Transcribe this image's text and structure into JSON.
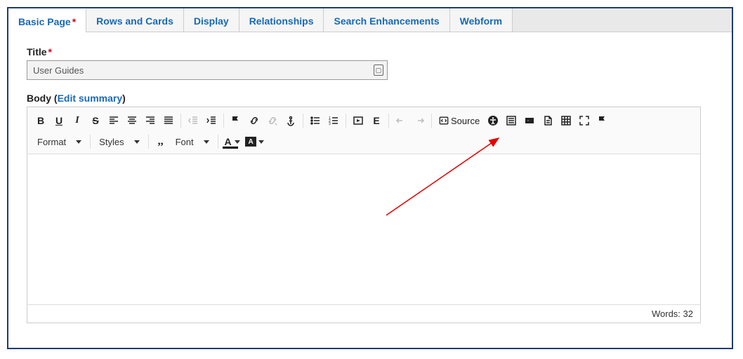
{
  "tabs": {
    "basic_page": "Basic Page",
    "rows_and_cards": "Rows and Cards",
    "display": "Display",
    "relationships": "Relationships",
    "search_enhancements": "Search Enhancements",
    "webform": "Webform"
  },
  "fields": {
    "title_label": "Title",
    "title_value": "User Guides",
    "body_label": "Body",
    "edit_summary": "Edit summary"
  },
  "toolbar": {
    "format": "Format",
    "styles": "Styles",
    "font": "Font",
    "source": "Source",
    "bold": "B",
    "underline": "U",
    "italic": "I",
    "strike": "S",
    "embed_e": "E",
    "text_a": "A",
    "bg_a": "A"
  },
  "footer": {
    "words_label": "Words:",
    "words_count": "32"
  }
}
